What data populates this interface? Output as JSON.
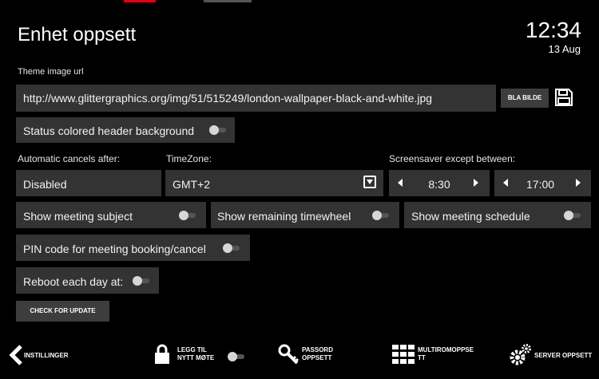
{
  "header": {
    "title": "Enhet oppsett",
    "clock_time": "12:34",
    "clock_date": "13 Aug"
  },
  "theme": {
    "label": "Theme image url",
    "url": "http://www.glittergraphics.org/img/51/515249/london-wallpaper-black-and-white.jpg",
    "browse_label": "BLA BILDE"
  },
  "status_header": {
    "label": "Status colored header background"
  },
  "auto_cancel": {
    "label": "Automatic cancels after:",
    "value": "Disabled"
  },
  "timezone": {
    "label": "TimeZone:",
    "value": "GMT+2"
  },
  "screensaver": {
    "label": "Screensaver except between:",
    "start": "8:30",
    "end": "17:00"
  },
  "toggles": {
    "meeting_subject": "Show meeting subject",
    "remaining_timewheel": "Show remaining timewheel",
    "meeting_schedule": "Show meeting schedule",
    "pin_code": "PIN code for meeting booking/cancel",
    "reboot": "Reboot each day at:"
  },
  "check_update_label": "CHECK FOR UPDATE",
  "footer": {
    "back_label": "INSTILLINGER",
    "add_meeting_line1": "LEGG TIL",
    "add_meeting_line2": "NYTT MØTE",
    "password_line1": "PASSORD",
    "password_line2": "OPPSETT",
    "multiroom_line1": "MULTIROMOPPSE",
    "multiroom_line2": "TT",
    "server_label": "SERVER OPPSETT"
  },
  "colors": {
    "background": "#000000",
    "field": "#333333",
    "accent_top": "#e0001b"
  }
}
